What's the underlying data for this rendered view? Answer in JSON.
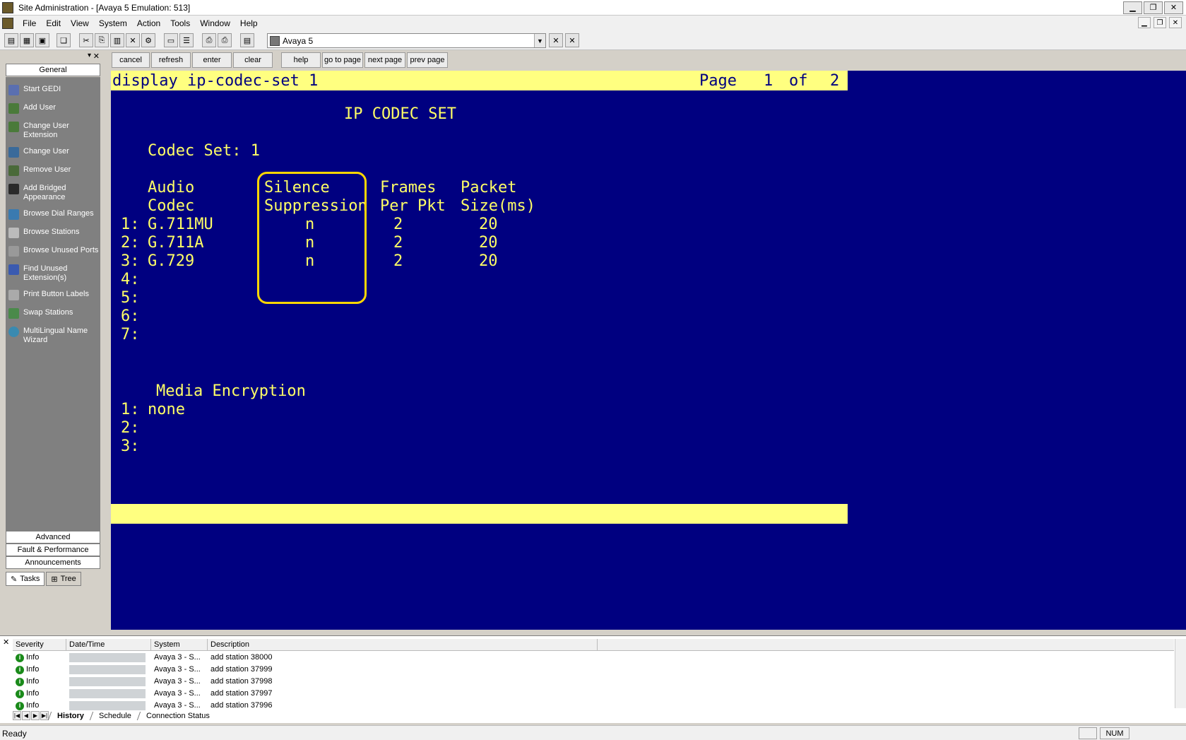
{
  "window": {
    "title": "Site Administration - [Avaya 5 Emulation: 513]",
    "minimize": "▁",
    "restore": "❐",
    "close": "✕"
  },
  "menu": [
    "File",
    "Edit",
    "View",
    "System",
    "Action",
    "Tools",
    "Window",
    "Help"
  ],
  "toolbar": {
    "system_value": "Avaya 5"
  },
  "left_pane": {
    "group_general": "General",
    "tasks": [
      {
        "label": "Start GEDI",
        "icon": "gedi-icon"
      },
      {
        "label": "Add User",
        "icon": "add-user-icon"
      },
      {
        "label": "Change User\nExtension",
        "icon": "change-extension-icon"
      },
      {
        "label": "Change User",
        "icon": "change-user-icon"
      },
      {
        "label": "Remove User",
        "icon": "remove-user-icon"
      },
      {
        "label": "Add Bridged\nAppearance",
        "icon": "bridged-appearance-icon"
      },
      {
        "label": "Browse Dial Ranges",
        "icon": "dial-ranges-icon"
      },
      {
        "label": "Browse Stations",
        "icon": "stations-icon"
      },
      {
        "label": "Browse Unused Ports",
        "icon": "unused-ports-icon"
      },
      {
        "label": "Find Unused\nExtension(s)",
        "icon": "find-extension-icon"
      },
      {
        "label": "Print Button Labels",
        "icon": "print-labels-icon"
      },
      {
        "label": "Swap Stations",
        "icon": "swap-stations-icon"
      },
      {
        "label": "MultiLingual Name\nWizard",
        "icon": "globe-icon"
      }
    ],
    "group_advanced": "Advanced",
    "group_fault": "Fault & Performance",
    "group_announcements": "Announcements",
    "tab_tasks": "Tasks",
    "tab_tree": "Tree"
  },
  "commands": [
    "cancel",
    "refresh",
    "enter",
    "clear",
    "help",
    "go to page",
    "next page",
    "prev page"
  ],
  "terminal": {
    "command": "display ip-codec-set 1",
    "page_label": "Page",
    "page_current": "1",
    "page_of": "of",
    "page_total": "2",
    "heading": "IP CODEC SET",
    "codec_set_label": "Codec Set: 1",
    "col_audio_1": "Audio",
    "col_audio_2": "Codec",
    "col_silence_1": "Silence",
    "col_silence_2": "Suppression",
    "col_frames_1": "Frames",
    "col_frames_2": "Per Pkt",
    "col_packet_1": "Packet",
    "col_packet_2": "Size(ms)",
    "rows": [
      {
        "num": "1:",
        "codec": "G.711MU",
        "silence": "n",
        "frames": "2",
        "packet": "20"
      },
      {
        "num": "2:",
        "codec": "G.711A",
        "silence": "n",
        "frames": "2",
        "packet": "20"
      },
      {
        "num": "3:",
        "codec": "G.729",
        "silence": "n",
        "frames": "2",
        "packet": "20"
      },
      {
        "num": "4:",
        "codec": "",
        "silence": "",
        "frames": "",
        "packet": ""
      },
      {
        "num": "5:",
        "codec": "",
        "silence": "",
        "frames": "",
        "packet": ""
      },
      {
        "num": "6:",
        "codec": "",
        "silence": "",
        "frames": "",
        "packet": ""
      },
      {
        "num": "7:",
        "codec": "",
        "silence": "",
        "frames": "",
        "packet": ""
      }
    ],
    "media_heading": "Media Encryption",
    "media_rows": [
      {
        "num": "1:",
        "value": "none"
      },
      {
        "num": "2:",
        "value": ""
      },
      {
        "num": "3:",
        "value": ""
      }
    ]
  },
  "log": {
    "headers": [
      "Severity",
      "Date/Time",
      "System",
      "Description"
    ],
    "rows": [
      {
        "severity": "Info",
        "system": "Avaya 3 - S...",
        "description": "add station 38000"
      },
      {
        "severity": "Info",
        "system": "Avaya 3 - S...",
        "description": "add station 37999"
      },
      {
        "severity": "Info",
        "system": "Avaya 3 - S...",
        "description": "add station 37998"
      },
      {
        "severity": "Info",
        "system": "Avaya 3 - S...",
        "description": "add station 37997"
      },
      {
        "severity": "Info",
        "system": "Avaya 3 - S...",
        "description": "add station 37996"
      }
    ],
    "tabs": [
      "History",
      "Schedule",
      "Connection Status"
    ]
  },
  "status": {
    "text": "Ready",
    "num": "NUM"
  },
  "colors": {
    "terminal_bg": "#000080",
    "terminal_fg": "#ffff66",
    "bar_bg": "#ffff80",
    "highlight": "#ffd700"
  }
}
